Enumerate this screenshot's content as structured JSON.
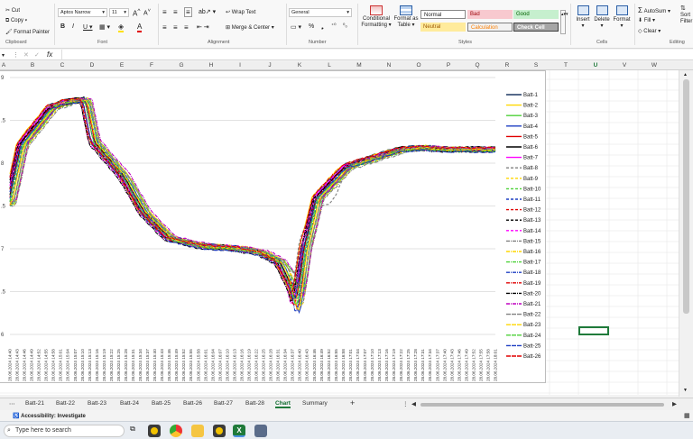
{
  "ribbon": {
    "clipboard": {
      "cut": "Cut",
      "copy": "Copy",
      "format_painter": "Format Painter",
      "label": "Clipboard"
    },
    "font": {
      "name": "Aptos Narrow",
      "size": "11",
      "label": "Font"
    },
    "alignment": {
      "wrap": "Wrap Text",
      "merge": "Merge & Center",
      "label": "Alignment"
    },
    "number": {
      "format": "General",
      "label": "Number"
    },
    "styles": {
      "cond": "Conditional Formatting",
      "table": "Format as Table",
      "normal": "Normal",
      "bad": "Bad",
      "good": "Good",
      "neutral": "Neutral",
      "calculation": "Calculation",
      "check": "Check Cell",
      "label": "Styles"
    },
    "cells": {
      "insert": "Insert",
      "delete": "Delete",
      "format": "Format",
      "label": "Cells"
    },
    "editing": {
      "autosum": "AutoSum",
      "fill": "Fill",
      "clear": "Clear",
      "sort": "Sort Filter",
      "label": "Editing"
    }
  },
  "formula_bar": {
    "fx": "fx",
    "value": ""
  },
  "columns": [
    "A",
    "B",
    "C",
    "D",
    "E",
    "F",
    "G",
    "H",
    "I",
    "J",
    "K",
    "L",
    "M",
    "N",
    "O",
    "P",
    "Q",
    "R",
    "S",
    "T",
    "U",
    "V",
    "W"
  ],
  "chart_data": {
    "type": "line",
    "title": "",
    "ytick_labels": [
      "9",
      ".5",
      "8",
      ".5",
      "7",
      ".5",
      "6"
    ],
    "x_tick_labels": [
      "28.06.2024 14:40",
      "28.06.2024 14:43",
      "28.06.2024 14:46",
      "28.06.2024 14:49",
      "28.06.2024 14:52",
      "28.06.2024 14:55",
      "28.06.2024 14:58",
      "28.06.2024 15:01",
      "28.06.2024 15:04",
      "28.06.2024 15:07",
      "28.06.2024 15:10",
      "28.06.2024 15:13",
      "28.06.2024 15:16",
      "28.06.2024 15:19",
      "28.06.2024 15:22",
      "28.06.2024 15:25",
      "28.06.2024 15:28",
      "28.06.2024 15:31",
      "28.06.2024 15:34",
      "28.06.2024 15:37",
      "28.06.2024 15:40",
      "28.06.2024 15:43",
      "28.06.2024 15:46",
      "28.06.2024 15:49",
      "28.06.2024 15:52",
      "28.06.2024 15:55",
      "28.06.2024 15:58",
      "28.06.2024 16:01",
      "28.06.2024 16:04",
      "28.06.2024 16:07",
      "28.06.2024 16:10",
      "28.06.2024 16:13",
      "28.06.2024 16:16",
      "28.06.2024 16:19",
      "28.06.2024 16:22",
      "28.06.2024 16:25",
      "28.06.2024 16:28",
      "28.06.2024 16:31",
      "28.06.2024 16:34",
      "28.06.2024 16:37",
      "28.06.2024 16:40",
      "28.06.2024 16:43",
      "28.06.2024 16:46",
      "28.06.2024 16:49",
      "28.06.2024 16:52",
      "28.06.2024 16:55",
      "28.06.2024 16:58",
      "28.06.2024 17:01",
      "28.06.2024 17:04",
      "28.06.2024 17:07",
      "28.06.2024 17:10",
      "28.06.2024 17:13",
      "28.06.2024 17:16",
      "28.06.2024 17:19",
      "28.06.2024 17:22",
      "28.06.2024 17:25",
      "28.06.2024 17:28",
      "28.06.2024 17:31",
      "28.06.2024 17:34",
      "28.06.2024 17:37",
      "28.06.2024 17:40",
      "28.06.2024 17:43",
      "28.06.2024 17:46",
      "28.06.2024 17:49",
      "28.06.2024 17:52",
      "28.06.2024 17:55",
      "28.06.2024 17:58",
      "28.06.2024 18:01"
    ],
    "base_curve": [
      [
        0,
        7.53
      ],
      [
        3,
        8.22
      ],
      [
        10,
        8.65
      ],
      [
        14,
        8.72
      ],
      [
        18,
        8.74
      ],
      [
        20,
        8.25
      ],
      [
        27,
        7.85
      ],
      [
        32,
        7.42
      ],
      [
        38,
        7.12
      ],
      [
        46,
        7.03
      ],
      [
        55,
        7.0
      ],
      [
        60,
        6.95
      ],
      [
        64,
        6.85
      ],
      [
        67,
        6.55
      ],
      [
        68,
        6.38
      ],
      [
        69,
        6.62
      ],
      [
        70,
        6.98
      ],
      [
        73,
        7.6
      ],
      [
        80,
        7.96
      ],
      [
        93,
        8.16
      ],
      [
        98,
        8.18
      ],
      [
        103,
        8.16
      ],
      [
        115,
        8.16
      ]
    ],
    "series": [
      {
        "name": "Batt-1",
        "color": "#1f3864",
        "dash": ""
      },
      {
        "name": "Batt-2",
        "color": "#ffd700",
        "dash": ""
      },
      {
        "name": "Batt-3",
        "color": "#4cd137",
        "dash": ""
      },
      {
        "name": "Batt-4",
        "color": "#1d3ec2",
        "dash": ""
      },
      {
        "name": "Batt-5",
        "color": "#e00000",
        "dash": ""
      },
      {
        "name": "Batt-6",
        "color": "#000000",
        "dash": ""
      },
      {
        "name": "Batt-7",
        "color": "#ff00ff",
        "dash": ""
      },
      {
        "name": "Batt-8",
        "color": "#808080",
        "dash": "3,2"
      },
      {
        "name": "Batt-9",
        "color": "#ffd700",
        "dash": "3,2"
      },
      {
        "name": "Batt-10",
        "color": "#4cd137",
        "dash": "3,2"
      },
      {
        "name": "Batt-11",
        "color": "#1d3ec2",
        "dash": "3,2"
      },
      {
        "name": "Batt-12",
        "color": "#e00000",
        "dash": "3,2"
      },
      {
        "name": "Batt-13",
        "color": "#000000",
        "dash": "3,2"
      },
      {
        "name": "Batt-14",
        "color": "#ff00ff",
        "dash": "3,2"
      },
      {
        "name": "Batt-15",
        "color": "#808080",
        "dash": "4,1,1,1"
      },
      {
        "name": "Batt-16",
        "color": "#ffd700",
        "dash": "4,1,1,1"
      },
      {
        "name": "Batt-17",
        "color": "#4cd137",
        "dash": "4,1,1,1"
      },
      {
        "name": "Batt-18",
        "color": "#1d3ec2",
        "dash": "4,1,1,1"
      },
      {
        "name": "Batt-19",
        "color": "#e00000",
        "dash": "4,1,1,1"
      },
      {
        "name": "Batt-20",
        "color": "#000000",
        "dash": "4,1,1,1"
      },
      {
        "name": "Batt-21",
        "color": "#c000c0",
        "dash": "4,1,1,1"
      },
      {
        "name": "Batt-22",
        "color": "#808080",
        "dash": "5,1"
      },
      {
        "name": "Batt-23",
        "color": "#ffd700",
        "dash": "5,1"
      },
      {
        "name": "Batt-24",
        "color": "#4cd137",
        "dash": "5,1"
      },
      {
        "name": "Batt-25",
        "color": "#1d3ec2",
        "dash": "5,1"
      },
      {
        "name": "Batt-26",
        "color": "#e00000",
        "dash": "5,1"
      }
    ]
  },
  "sheet_tabs": [
    "Batt-21",
    "Batt-22",
    "Batt-23",
    "Batt-24",
    "Batt-25",
    "Batt-26",
    "Batt-27",
    "Batt-28",
    "Chart",
    "Summary"
  ],
  "active_tab": "Chart",
  "status": {
    "accessibility": "Accessibility: Investigate"
  },
  "taskbar": {
    "search_placeholder": "Type here to search"
  }
}
